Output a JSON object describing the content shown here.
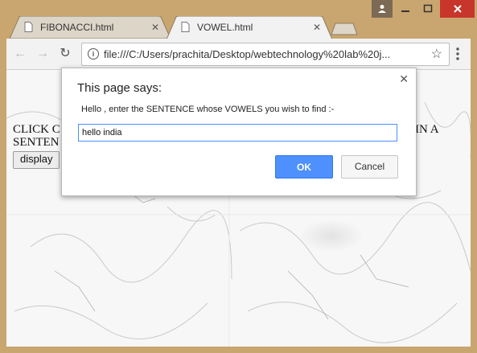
{
  "tabs": [
    {
      "label": "FIBONACCI.html",
      "active": false
    },
    {
      "label": "VOWEL.html",
      "active": true
    }
  ],
  "toolbar": {
    "url": "file:///C:/Users/prachita/Desktop/webtechnology%20lab%20j..."
  },
  "page": {
    "text_left_line1": "CLICK C",
    "text_left_line2": "SENTEN",
    "text_right": "IN A",
    "display_button": "display"
  },
  "dialog": {
    "title": "This page says:",
    "message": "Hello , enter the SENTENCE whose VOWELS you wish to find :-",
    "input_value": "hello india",
    "ok_label": "OK",
    "cancel_label": "Cancel"
  },
  "colors": {
    "frame": "#c9a66f",
    "accent": "#4d90fe",
    "close": "#c8352b"
  }
}
